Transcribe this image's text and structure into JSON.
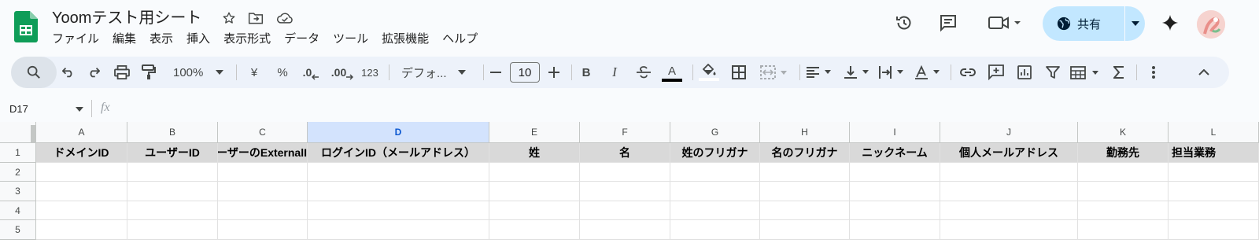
{
  "doc": {
    "title": "Yoomテスト用シート"
  },
  "menu": [
    "ファイル",
    "編集",
    "表示",
    "挿入",
    "表示形式",
    "データ",
    "ツール",
    "拡張機能",
    "ヘルプ"
  ],
  "header_icons": [
    "star-icon",
    "move-icon",
    "cloud-status-icon",
    "history-icon",
    "comment-icon",
    "video-meet-icon",
    "gemini-sparkle-icon"
  ],
  "share": {
    "label": "共有",
    "color": "#c2e7ff"
  },
  "toolbar": {
    "zoom": "100%",
    "currency": "¥",
    "percent": "%",
    "dec_decrease": ".0",
    "dec_increase": ".00",
    "number_format": "123",
    "font": "デフォ...",
    "font_size": "10",
    "bold": "B",
    "italic": "I",
    "text_color": "A",
    "text_color_bar": "#000000",
    "fill_color_bar": "#ffffff"
  },
  "formula_bar": {
    "name_box": "D17",
    "fx": "fx",
    "value": ""
  },
  "grid": {
    "columns": [
      "A",
      "B",
      "C",
      "D",
      "E",
      "F",
      "G",
      "H",
      "I",
      "J",
      "K",
      "L"
    ],
    "selected_column": "D",
    "rows": [
      "1",
      "2",
      "3",
      "4",
      "5"
    ],
    "header_row": [
      "ドメインID",
      "ユーザーID",
      "ーザーのExternalI",
      "ログインID（メールアドレス）",
      "姓",
      "名",
      "姓のフリガナ",
      "名のフリガナ",
      "ニックネーム",
      "個人メールアドレス",
      "勤務先",
      "担当業務"
    ],
    "header_fill": "#d9d9d9"
  }
}
